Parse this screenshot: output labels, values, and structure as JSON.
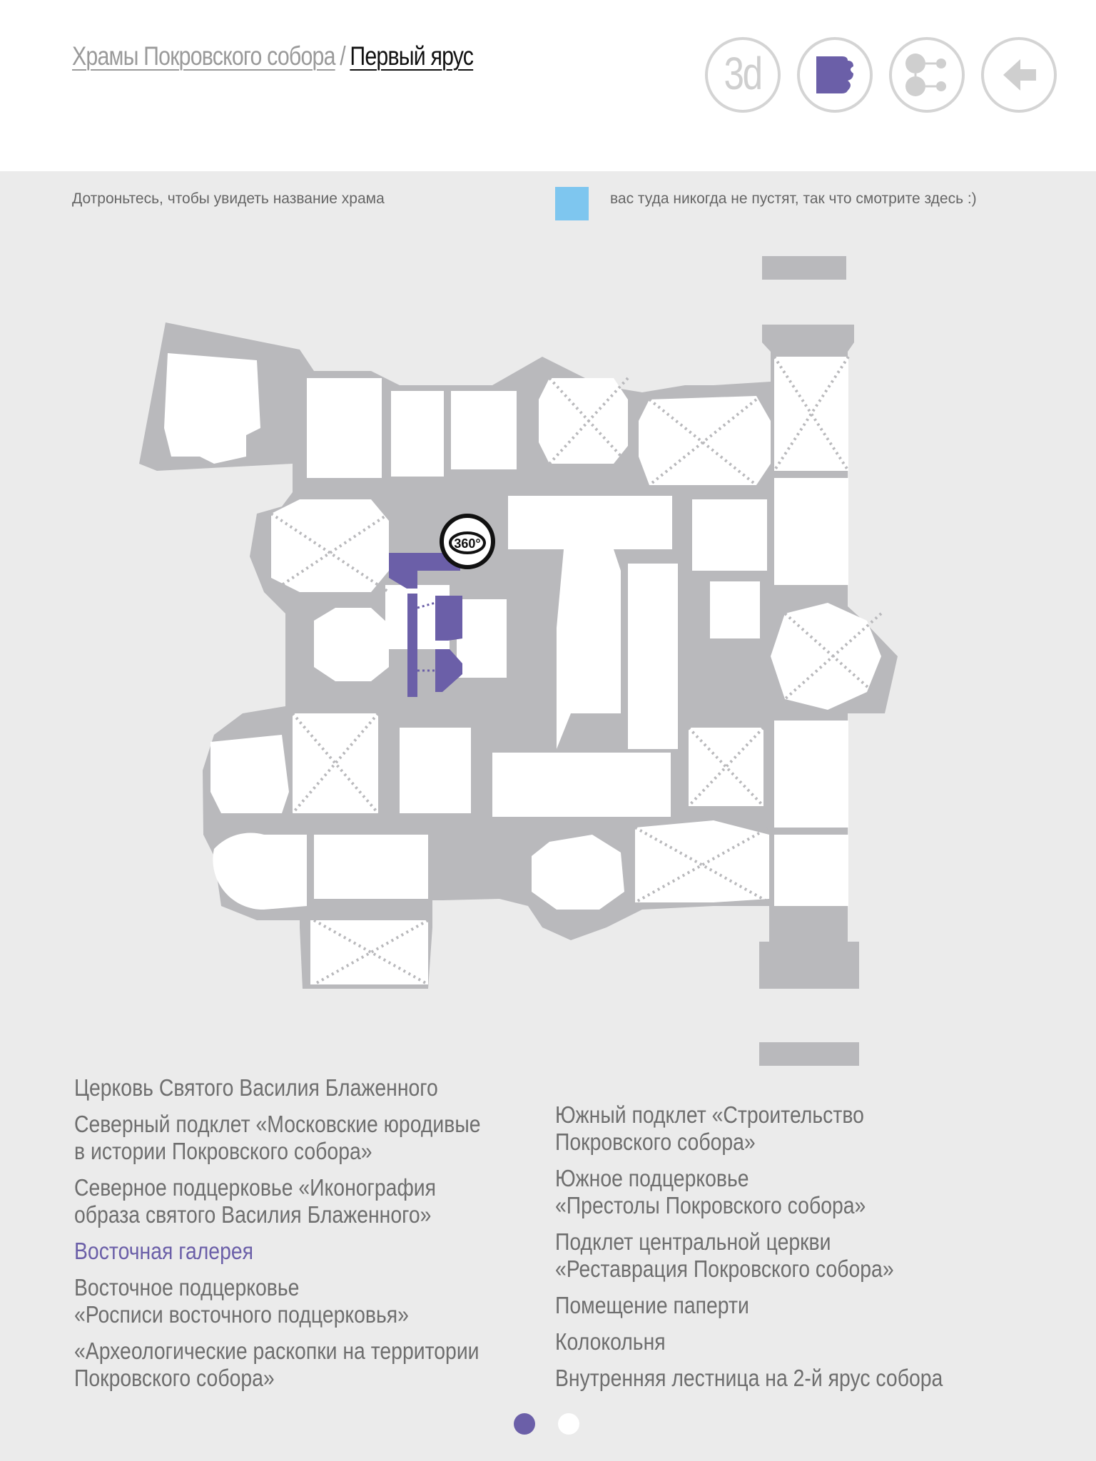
{
  "breadcrumb": {
    "parent": "Храмы Покровского собора",
    "separator": "/",
    "current": "Первый ярус"
  },
  "toolbar": {
    "btn_3d_label": "3d",
    "buttons": [
      "3d-view",
      "floor-plan",
      "connections",
      "back"
    ],
    "active_button": "floor-plan"
  },
  "hint": {
    "touch_text": "Дотроньтесь, чтобы увидеть название храма",
    "legend_text": "вас туда никогда не пустят, так что смотрите здесь :)"
  },
  "plan": {
    "panorama_label": "360°",
    "highlighted_room": "Восточная галерея"
  },
  "rooms": {
    "left": [
      "Церковь Святого Василия Блаженного",
      "Северный подклет «Московские юродивые\nв истории Покровского собора»",
      "Северное подцерковье «Иконография\nобраза святого Василия Блаженного»",
      "Восточная галерея",
      "Восточное подцерковье\n«Росписи восточного подцерковья»",
      "«Археологические раскопки на территории\nПокровского собора»"
    ],
    "right": [
      "Южный подклет «Строительство\nПокровского собора»",
      "Южное подцерковье\n«Престолы Покровского собора»",
      "Подклет центральной церкви\n«Реставрация Покровского собора»",
      "Помещение паперти",
      "Колокольня",
      "Внутренняя лестница на 2-й ярус собора"
    ],
    "active": "Восточная галерея"
  },
  "pagination": {
    "pages": 2,
    "current": 1
  },
  "colors": {
    "accent": "#6b5fa8",
    "wall": "#b9b9bc",
    "room": "#ffffff",
    "legend_blue": "#7ec6ef",
    "background": "#ebebeb"
  }
}
